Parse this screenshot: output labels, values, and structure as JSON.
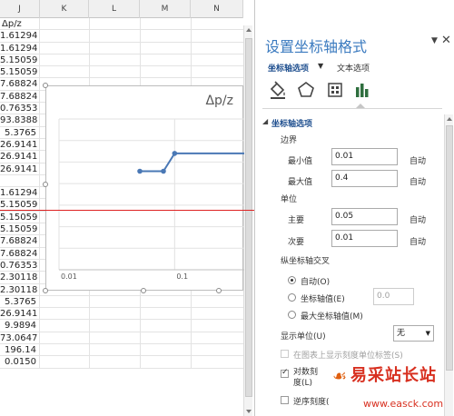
{
  "sheet": {
    "columns": [
      "J",
      "K",
      "L",
      "M",
      "N"
    ],
    "header_cell": "Δp/z",
    "cells": [
      "1.61294",
      "1.61294",
      "5.15059",
      "5.15059",
      "7.68824",
      "7.68824",
      "0.76353",
      "93.8388",
      "5.3765",
      "26.9141",
      "26.9141",
      "26.9141",
      "",
      "1.61294",
      "5.15059",
      "5.15059",
      "5.15059",
      "7.68824",
      "7.68824",
      "0.76353",
      "2.30118",
      "2.30118",
      "5.3765",
      "26.9141",
      "9.9894",
      "73.0647",
      "196.14",
      "0.0150"
    ]
  },
  "chart": {
    "title": "Δp/z",
    "x_tick_labels": [
      "0.01",
      "0.1"
    ]
  },
  "chart_data": {
    "type": "line",
    "title": "Δp/z",
    "xscale": "log",
    "xlim": [
      0.01,
      0.4
    ],
    "x_tick_labels": [
      "0.01",
      "0.1"
    ],
    "series": [
      {
        "x": [
          0.05,
          0.08,
          0.1,
          0.4
        ],
        "y": [
          1.61,
          1.61,
          5.15,
          5.15
        ]
      }
    ],
    "grid": true
  },
  "pane": {
    "title": "设置坐标轴格式",
    "tab_axis_options": "坐标轴选项",
    "tab_text_options": "文本选项",
    "section_title": "坐标轴选项",
    "bounds_label": "边界",
    "min_label": "最小值",
    "min_value": "0.01",
    "max_label": "最大值",
    "max_value": "0.4",
    "auto_label": "自动",
    "units_label": "单位",
    "major_label": "主要",
    "major_value": "0.05",
    "minor_label": "次要",
    "minor_value": "0.01",
    "cross_label": "纵坐标轴交叉",
    "cross_auto": "自动(O)",
    "cross_value_label": "坐标轴值(E)",
    "cross_value": "0.0",
    "cross_max": "最大坐标轴值(M)",
    "display_units_label": "显示单位(U)",
    "display_units_value": "无",
    "show_units_label": "在图表上显示刻度单位标签(S)",
    "log_scale_line1": "对数刻",
    "log_scale_line2": "度(L)",
    "reverse_label": "逆序刻度("
  },
  "watermark": {
    "text": "易采站长站",
    "url": "www.easck.com"
  },
  "colors": {
    "accent": "#3a7abf",
    "series_line": "#4a78b5",
    "red_line": "#dd2222"
  }
}
